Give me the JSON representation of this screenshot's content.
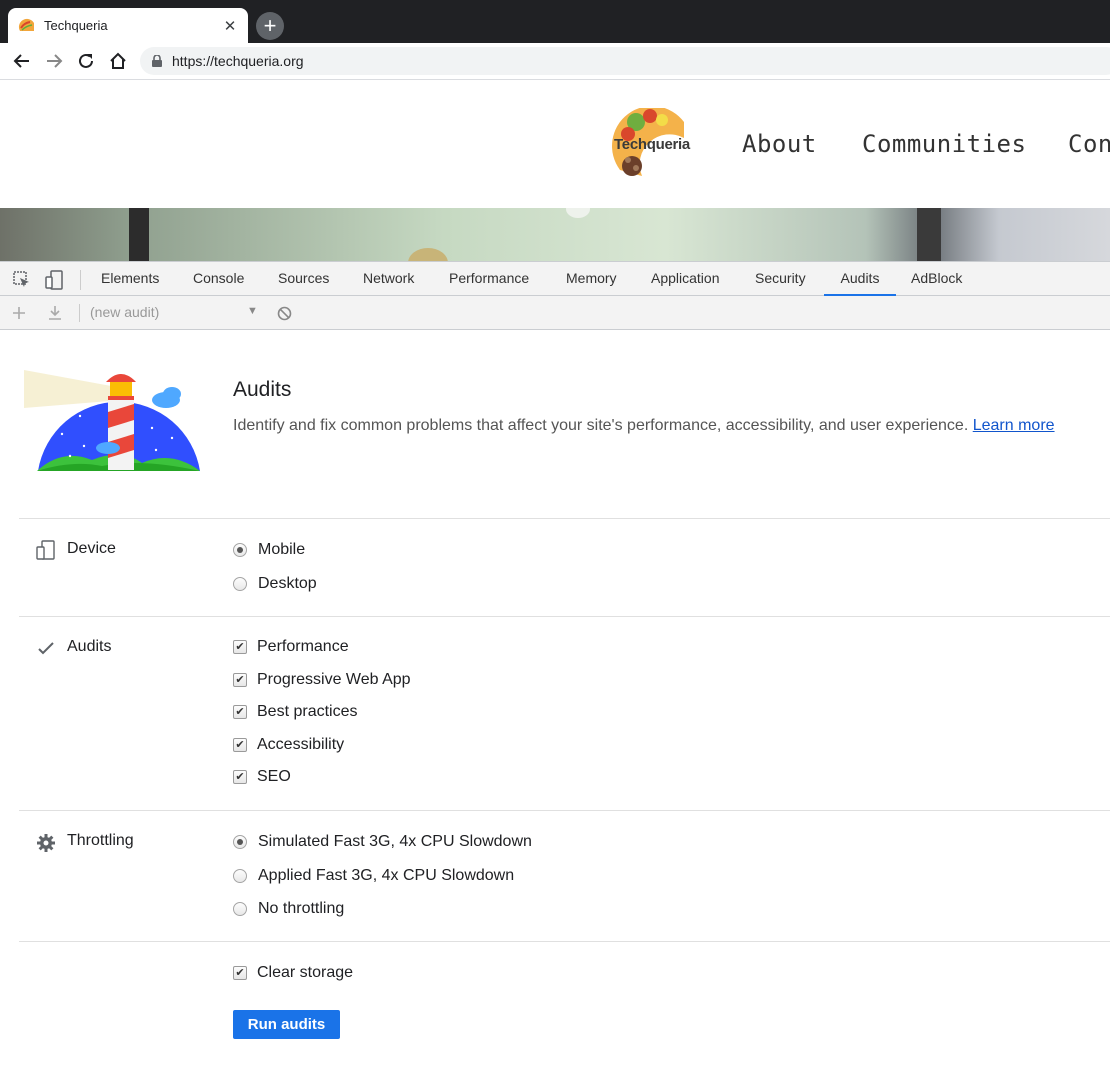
{
  "browser": {
    "tab_title": "Techqueria",
    "tab_close": "✕",
    "new_tab": "+",
    "url": "https://techqueria.org"
  },
  "site": {
    "logo_text": "Techqueria",
    "nav": [
      "About",
      "Communities",
      "Con"
    ]
  },
  "devtools": {
    "tabs": [
      "Elements",
      "Console",
      "Sources",
      "Network",
      "Performance",
      "Memory",
      "Application",
      "Security",
      "Audits",
      "AdBlock"
    ],
    "active_tab": "Audits",
    "audit_select": "(new audit)",
    "accent": "#1a73e8"
  },
  "audits": {
    "title": "Audits",
    "description": "Identify and fix common problems that affect your site's performance, accessibility, and user experience.",
    "learn_more": "Learn more",
    "device": {
      "label": "Device",
      "options": [
        "Mobile",
        "Desktop"
      ],
      "selected": "Mobile"
    },
    "categories": {
      "label": "Audits",
      "options": [
        "Performance",
        "Progressive Web App",
        "Best practices",
        "Accessibility",
        "SEO"
      ]
    },
    "throttling": {
      "label": "Throttling",
      "options": [
        "Simulated Fast 3G, 4x CPU Slowdown",
        "Applied Fast 3G, 4x CPU Slowdown",
        "No throttling"
      ],
      "selected": "Simulated Fast 3G, 4x CPU Slowdown"
    },
    "clear_storage": "Clear storage",
    "run_button": "Run audits"
  }
}
